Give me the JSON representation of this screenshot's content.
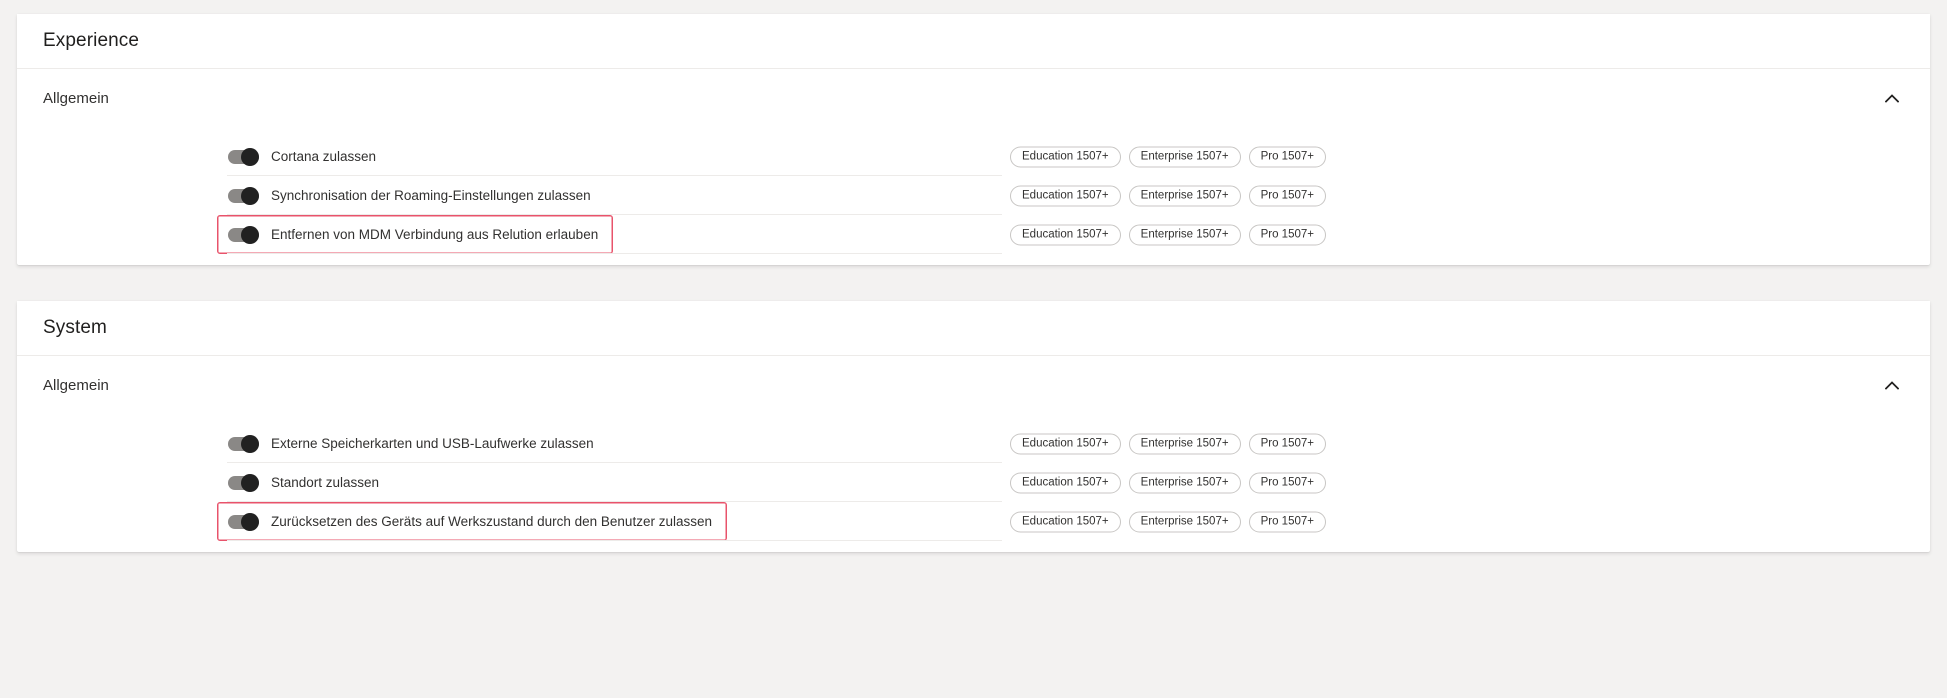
{
  "cards": [
    {
      "title": "Experience",
      "group": {
        "title": "Allgemein",
        "collapse_icon": "chevron-up-icon",
        "expanded": true
      },
      "rows": [
        {
          "label": "Cortana zulassen",
          "toggle_on": true,
          "highlighted": false,
          "badges": [
            "Education 1507+",
            "Enterprise 1507+",
            "Pro 1507+"
          ]
        },
        {
          "label": "Synchronisation der Roaming-Einstellungen zulassen",
          "toggle_on": true,
          "highlighted": false,
          "badges": [
            "Education 1507+",
            "Enterprise 1507+",
            "Pro 1507+"
          ]
        },
        {
          "label": "Entfernen von MDM Verbindung aus Relution erlauben",
          "toggle_on": true,
          "highlighted": true,
          "badges": [
            "Education 1507+",
            "Enterprise 1507+",
            "Pro 1507+"
          ]
        }
      ]
    },
    {
      "title": "System",
      "group": {
        "title": "Allgemein",
        "collapse_icon": "chevron-up-icon",
        "expanded": true
      },
      "rows": [
        {
          "label": "Externe Speicherkarten und USB-Laufwerke zulassen",
          "toggle_on": true,
          "highlighted": false,
          "badges": [
            "Education 1507+",
            "Enterprise 1507+",
            "Pro 1507+"
          ]
        },
        {
          "label": "Standort zulassen",
          "toggle_on": true,
          "highlighted": false,
          "badges": [
            "Education 1507+",
            "Enterprise 1507+",
            "Pro 1507+"
          ]
        },
        {
          "label": "Zurücksetzen des Geräts auf Werkszustand durch den Benutzer zulassen",
          "toggle_on": true,
          "highlighted": true,
          "badges": [
            "Education 1507+",
            "Enterprise 1507+",
            "Pro 1507+"
          ]
        }
      ]
    }
  ],
  "colors": {
    "page_background": "#f3f2f1",
    "card_background": "#ffffff",
    "highlight_border": "#e8536b",
    "toggle_track": "#8a8886",
    "toggle_knob": "#212121",
    "divider": "#edebe9",
    "badge_border": "#c8c6c4",
    "text_primary": "#323130"
  }
}
